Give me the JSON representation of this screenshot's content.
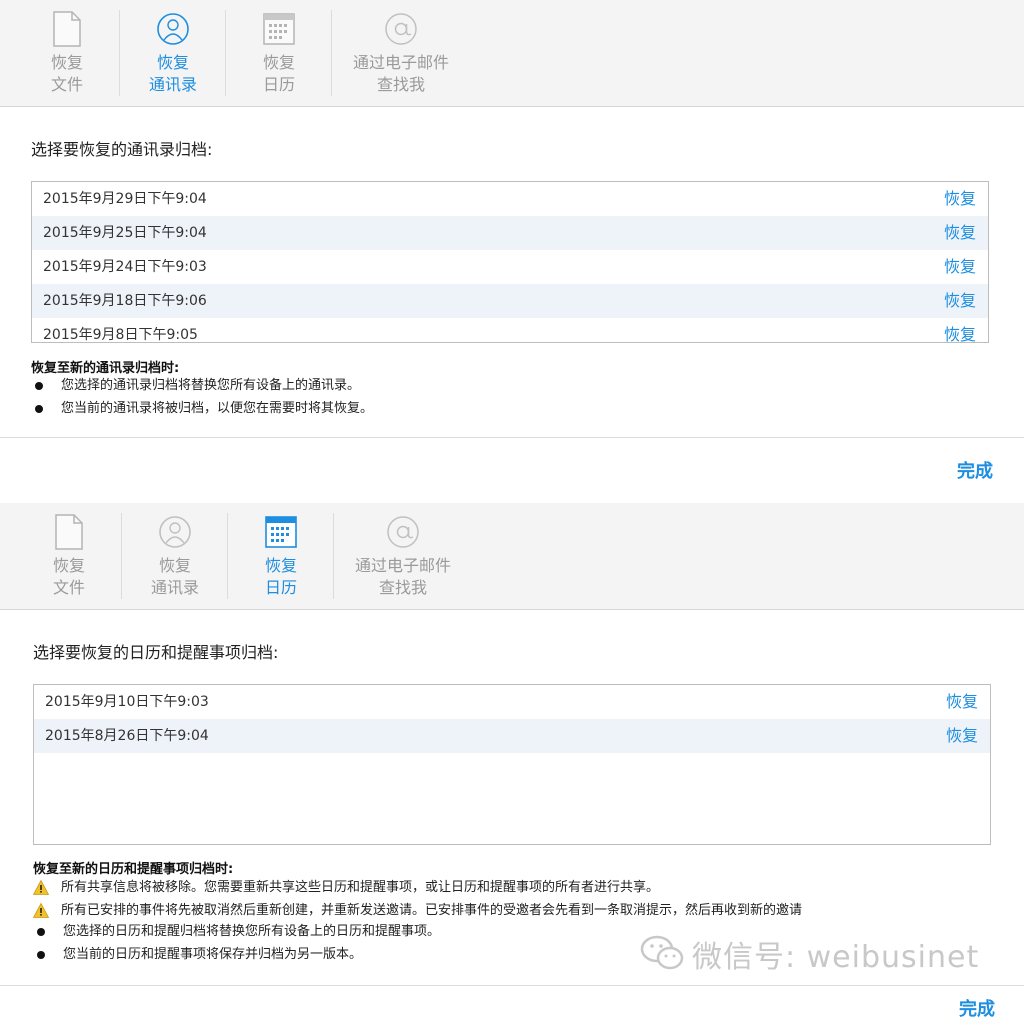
{
  "panel1": {
    "tabs": [
      {
        "line1": "恢复",
        "line2": "文件"
      },
      {
        "line1": "恢复",
        "line2": "通讯录"
      },
      {
        "line1": "恢复",
        "line2": "日历"
      },
      {
        "line1": "通过电子邮件",
        "line2": "查找我"
      }
    ],
    "active_tab": 1,
    "section_title": "选择要恢复的通讯录归档:",
    "rows": [
      {
        "date": "2015年9月29日下午9:04",
        "action": "恢复"
      },
      {
        "date": "2015年9月25日下午9:04",
        "action": "恢复"
      },
      {
        "date": "2015年9月24日下午9:03",
        "action": "恢复"
      },
      {
        "date": "2015年9月18日下午9:06",
        "action": "恢复"
      },
      {
        "date": "2015年9月8日下午9:05",
        "action": "恢复"
      }
    ],
    "note_title": "恢复至新的通讯录归档时:",
    "notes": [
      "您选择的通讯录归档将替换您所有设备上的通讯录。",
      "您当前的通讯录将被归档，以便您在需要时将其恢复。"
    ],
    "done_label": "完成"
  },
  "panel2": {
    "tabs": [
      {
        "line1": "恢复",
        "line2": "文件"
      },
      {
        "line1": "恢复",
        "line2": "通讯录"
      },
      {
        "line1": "恢复",
        "line2": "日历"
      },
      {
        "line1": "通过电子邮件",
        "line2": "查找我"
      }
    ],
    "active_tab": 2,
    "section_title": "选择要恢复的日历和提醒事项归档:",
    "rows": [
      {
        "date": "2015年9月10日下午9:03",
        "action": "恢复"
      },
      {
        "date": "2015年8月26日下午9:04",
        "action": "恢复"
      }
    ],
    "note_title": "恢复至新的日历和提醒事项归档时:",
    "warnings": [
      "所有共享信息将被移除。您需要重新共享这些日历和提醒事项，或让日历和提醒事项的所有者进行共享。",
      "所有已安排的事件将先被取消然后重新创建，并重新发送邀请。已安排事件的受邀者会先看到一条取消提示，然后再收到新的邀请"
    ],
    "notes": [
      "您选择的日历和提醒归档将替换您所有设备上的日历和提醒事项。",
      "您当前的日历和提醒事项将保存并归档为另一版本。"
    ],
    "done_label": "完成"
  },
  "colors": {
    "accent": "#1d8ee0",
    "toolbar_bg": "#f4f4f4",
    "row_alt": "#eef3fa"
  },
  "icons": [
    "document-icon",
    "contact-icon",
    "calendar-icon",
    "at-icon",
    "warning-icon",
    "wechat-icon"
  ],
  "watermark": "微信号: weibusinet"
}
